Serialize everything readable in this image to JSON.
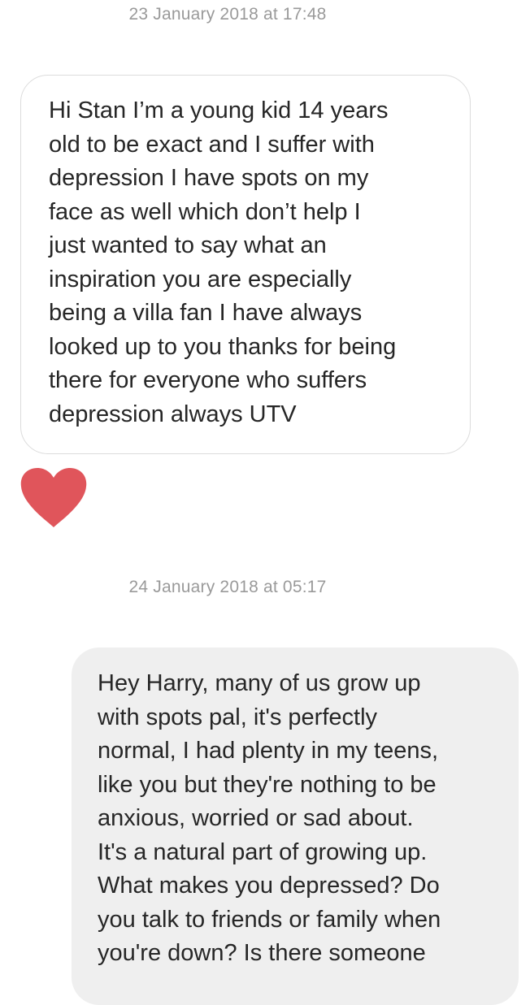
{
  "conversation": {
    "messages": [
      {
        "timestamp": "23 January 2018 at 17:48",
        "direction": "received",
        "lines": [
          "Hi Stan I’m a young kid 14 years",
          "old to be exact and I suffer with",
          "depression I have spots on my",
          "face as well which don’t help I",
          "just wanted to say what an",
          "inspiration you are especially",
          "being a villa fan I have always",
          "looked up to you thanks for being",
          "there for everyone who suffers",
          "depression always UTV"
        ],
        "reaction": "heart-icon",
        "reaction_color": "#e0555b"
      },
      {
        "timestamp": "24 January 2018 at 05:17",
        "direction": "sent",
        "lines": [
          "Hey Harry, many of us grow up",
          "with spots pal, it's perfectly",
          "normal, I had plenty in my teens,",
          "like you but they're nothing to be",
          "anxious, worried or sad about.",
          "It's a natural part of growing up.",
          "What makes you depressed? Do",
          "you talk to friends or family when",
          "you're down? Is there someone"
        ]
      }
    ]
  },
  "colors": {
    "timestamp_text": "#9a9a9a",
    "received_bubble_border": "#dcdcdc",
    "sent_bubble_background": "#efefef",
    "message_text": "#262626"
  }
}
